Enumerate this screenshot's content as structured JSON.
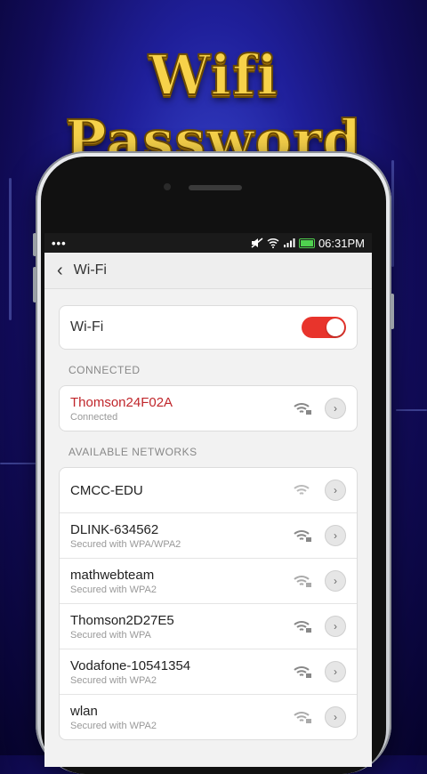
{
  "banner": {
    "title": "Wifi Password"
  },
  "status_bar": {
    "dots": "•••",
    "time": "06:31PM"
  },
  "header": {
    "back_icon": "chevron-left-icon",
    "title": "Wi-Fi"
  },
  "wifi_toggle": {
    "label": "Wi-Fi",
    "on": true,
    "accent": "#e8342c"
  },
  "sections": {
    "connected": "CONNECTED",
    "available": "AVAILABLE NETWORKS"
  },
  "connected": {
    "name": "Thomson24F02A",
    "status": "Connected",
    "color": "#c0262b"
  },
  "networks": [
    {
      "name": "CMCC-EDU",
      "security": "",
      "locked": false
    },
    {
      "name": "DLINK-634562",
      "security": "Secured with WPA/WPA2",
      "locked": true
    },
    {
      "name": "mathwebteam",
      "security": "Secured with WPA2",
      "locked": true
    },
    {
      "name": "Thomson2D27E5",
      "security": "Secured with WPA",
      "locked": true
    },
    {
      "name": "Vodafone-10541354",
      "security": "Secured with WPA2",
      "locked": true
    },
    {
      "name": "wlan",
      "security": "Secured with WPA2",
      "locked": true
    }
  ]
}
